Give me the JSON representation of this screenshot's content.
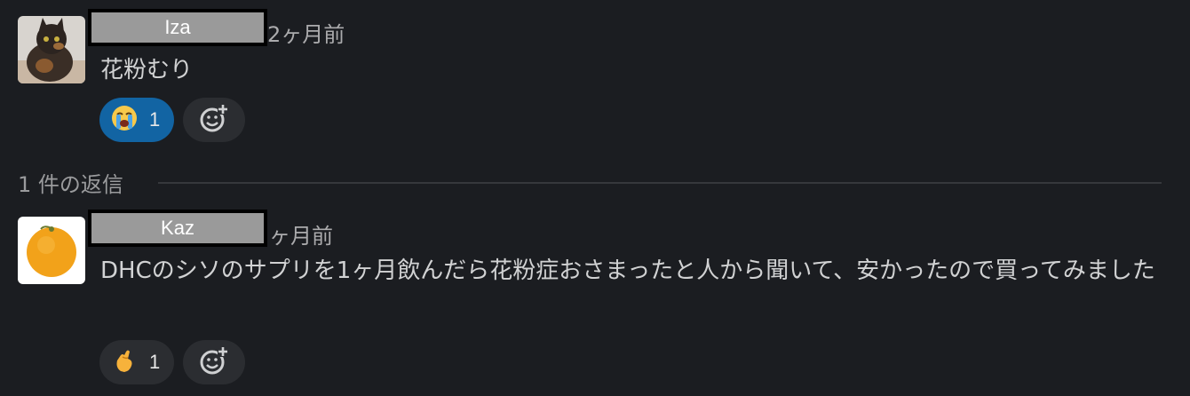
{
  "thread": {
    "parent": {
      "author": "Iza",
      "time": "2ヶ月前",
      "text": "花粉むり",
      "reaction": {
        "emoji": "loudly-crying-face",
        "count": "1"
      }
    },
    "replies_label": "1 件の返信",
    "reply": {
      "author": "Kaz",
      "time": "ヶ月前",
      "text": "DHCのシソのサプリを1ヶ月飲んだら花粉症おさまったと人から聞いて、安かったので買ってみました",
      "reaction": {
        "emoji": "pinching-hand",
        "count": "1"
      }
    }
  },
  "colors": {
    "background": "#1b1d21",
    "reaction_active": "#1264a3",
    "reaction_plain": "#2b2d31"
  }
}
